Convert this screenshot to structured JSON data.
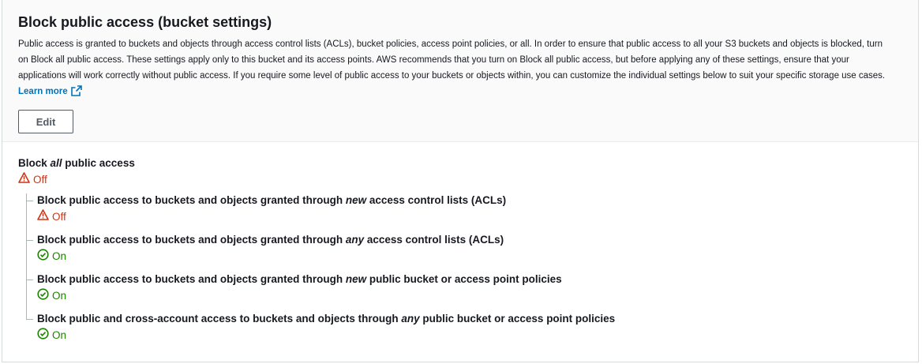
{
  "header": {
    "title": "Block public access (bucket settings)",
    "description": "Public access is granted to buckets and objects through access control lists (ACLs), bucket policies, access point policies, or all. In order to ensure that public access to all your S3 buckets and objects is blocked, turn on Block all public access. These settings apply only to this bucket and its access points. AWS recommends that you turn on Block all public access, but before applying any of these settings, ensure that your applications will work correctly without public access. If you require some level of public access to your buckets or objects within, you can customize the individual settings below to suit your specific storage use cases.",
    "learn_more": "Learn more",
    "edit_label": "Edit"
  },
  "block_all": {
    "label_pre": "Block ",
    "label_em": "all",
    "label_post": " public access",
    "status": "Off"
  },
  "settings": [
    {
      "pre": "Block public access to buckets and objects granted through ",
      "em": "new",
      "post": " access control lists (ACLs)",
      "status": "Off"
    },
    {
      "pre": "Block public access to buckets and objects granted through ",
      "em": "any",
      "post": " access control lists (ACLs)",
      "status": "On"
    },
    {
      "pre": "Block public access to buckets and objects granted through ",
      "em": "new",
      "post": " public bucket or access point policies",
      "status": "On"
    },
    {
      "pre": "Block public and cross-account access to buckets and objects through ",
      "em": "any",
      "post": " public bucket or access point policies",
      "status": "On"
    }
  ],
  "colors": {
    "off": "#d13212",
    "on": "#1d8102",
    "link": "#0073bb"
  }
}
